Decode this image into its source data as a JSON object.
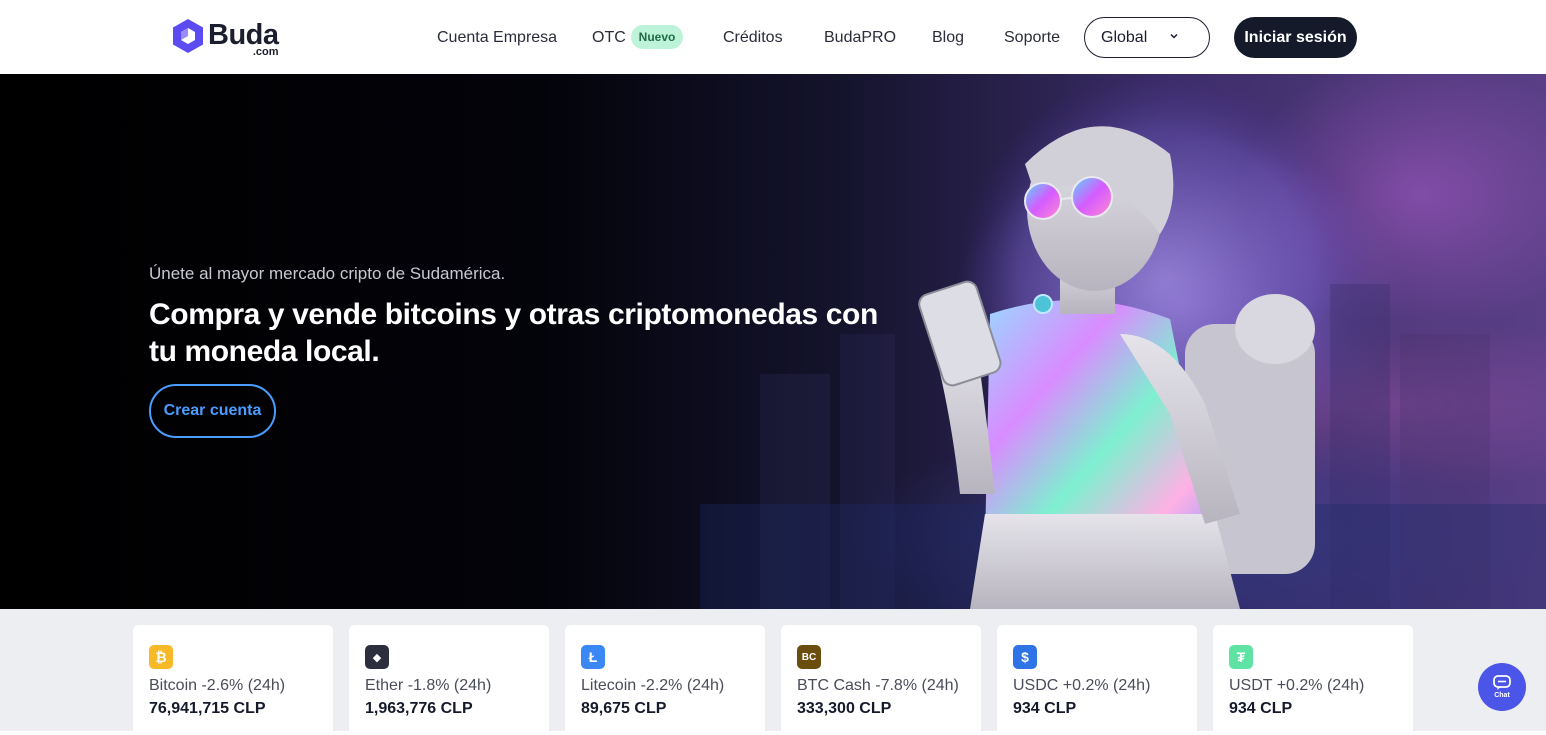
{
  "header": {
    "logo_text": "Buda",
    "logo_sub": ".com",
    "nav": {
      "cuenta_empresa": "Cuenta Empresa",
      "otc": "OTC",
      "otc_badge": "Nuevo",
      "creditos": "Créditos",
      "budapro": "BudaPRO",
      "blog": "Blog",
      "soporte": "Soporte"
    },
    "region_select": "Global",
    "login": "Iniciar sesión"
  },
  "hero": {
    "subtitle": "Únete al mayor mercado cripto de Sudamérica.",
    "title": "Compra y vende bitcoins y otras criptomonedas con tu moneda local.",
    "cta": "Crear cuenta"
  },
  "prices": [
    {
      "icon": "bitcoin-icon",
      "color": "#f7b928",
      "glyph": "₿",
      "change": "Bitcoin -2.6% (24h)",
      "price": "76,941,715 CLP"
    },
    {
      "icon": "ether-icon",
      "color": "#2c2f3d",
      "glyph": "◆",
      "change": "Ether -1.8% (24h)",
      "price": "1,963,776 CLP"
    },
    {
      "icon": "litecoin-icon",
      "color": "#3a87f5",
      "glyph": "Ł",
      "change": "Litecoin -2.2% (24h)",
      "price": "89,675 CLP"
    },
    {
      "icon": "btc-cash-icon",
      "color": "#6b4e0e",
      "glyph": "BC",
      "change": "BTC Cash -7.8% (24h)",
      "price": "333,300 CLP"
    },
    {
      "icon": "usdc-icon",
      "color": "#2f74e6",
      "glyph": "$",
      "change": "USDC +0.2% (24h)",
      "price": "934 CLP"
    },
    {
      "icon": "usdt-icon",
      "color": "#5fe3a5",
      "glyph": "₮",
      "change": "USDT +0.2% (24h)",
      "price": "934 CLP"
    }
  ],
  "chat": {
    "label": "Chat"
  },
  "colors": {
    "brand": "#4b55e8",
    "dark": "#151a2b",
    "accent_blue": "#4a9cff",
    "badge_green": "#bdf3d8"
  }
}
